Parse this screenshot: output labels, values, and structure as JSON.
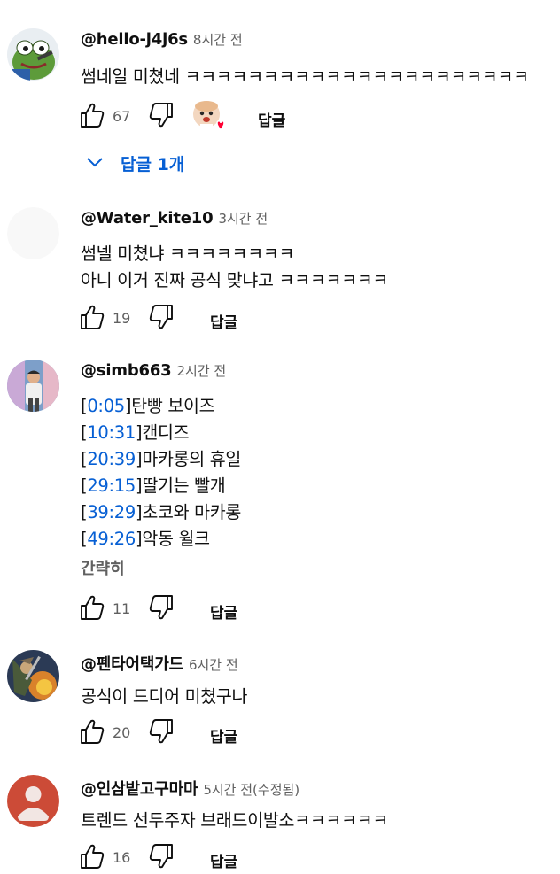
{
  "comments": [
    {
      "author": "@hello-j4j6s",
      "time": "8시간 전",
      "lines": [
        "썸네일 미쳤네 ㅋㅋㅋㅋㅋㅋㅋㅋㅋㅋㅋㅋㅋㅋㅋㅋㅋㅋㅋㅋㅋㅋ"
      ],
      "likes": "67",
      "reply_label": "답글",
      "creator_heart": true,
      "replies_toggle": "답글 1개",
      "avatar_icon": "frog-avatar-icon"
    },
    {
      "author": "@Water_kite10",
      "time": "3시간 전",
      "lines": [
        "썸넬 미쳤냐 ㅋㅋㅋㅋㅋㅋㅋㅋ",
        "아니 이거 진짜 공식 맞냐고 ㅋㅋㅋㅋㅋㅋㅋ"
      ],
      "likes": "19",
      "reply_label": "답글",
      "avatar_icon": "blank-avatar-icon"
    },
    {
      "author": "@simb663",
      "time": "2시간 전",
      "chapters": [
        {
          "ts": "0:05",
          "title": "탄빵 보이즈"
        },
        {
          "ts": "10:31",
          "title": "캔디즈"
        },
        {
          "ts": "20:39",
          "title": "마카롱의 휴일"
        },
        {
          "ts": "29:15",
          "title": "딸기는 빨개"
        },
        {
          "ts": "39:29",
          "title": "초코와 마카롱"
        },
        {
          "ts": "49:26",
          "title": "악동 윌크"
        }
      ],
      "show_less": "간략히",
      "likes": "11",
      "reply_label": "답글",
      "avatar_icon": "photo-avatar-icon"
    },
    {
      "author": "@펜타어택가드",
      "time": "6시간 전",
      "lines": [
        "공식이 드디어 미쳤구나"
      ],
      "likes": "20",
      "reply_label": "답글",
      "avatar_icon": "fantasy-avatar-icon"
    },
    {
      "author": "@인삼밭고구마마",
      "time": "5시간 전(수정됨)",
      "lines": [
        "트렌드 선두주자 브래드이발소ㅋㅋㅋㅋㅋㅋ"
      ],
      "likes": "16",
      "reply_label": "답글",
      "avatar_icon": "default-user-avatar-icon"
    }
  ],
  "colors": {
    "link": "#065fd4",
    "secondary_text": "#606060",
    "primary_text": "#0f0f0f",
    "heart": "#ff0033"
  }
}
